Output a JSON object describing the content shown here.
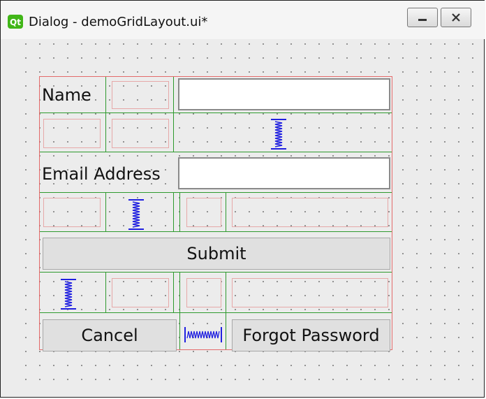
{
  "window": {
    "title": "Dialog - demoGridLayout.ui*",
    "icons": {
      "app": "qt-logo-icon",
      "minimize": "minimize-icon",
      "close": "close-icon"
    }
  },
  "form": {
    "name_label": "Name",
    "email_label": "Email Address",
    "name_value": "",
    "email_value": "",
    "submit_label": "Submit",
    "cancel_label": "Cancel",
    "forgot_label": "Forgot Password"
  },
  "colors": {
    "layout_border": "#e46a6a",
    "grid_line": "#2e9a2e",
    "spacer": "#2020e0",
    "placeholder": "#e6a8a8"
  }
}
